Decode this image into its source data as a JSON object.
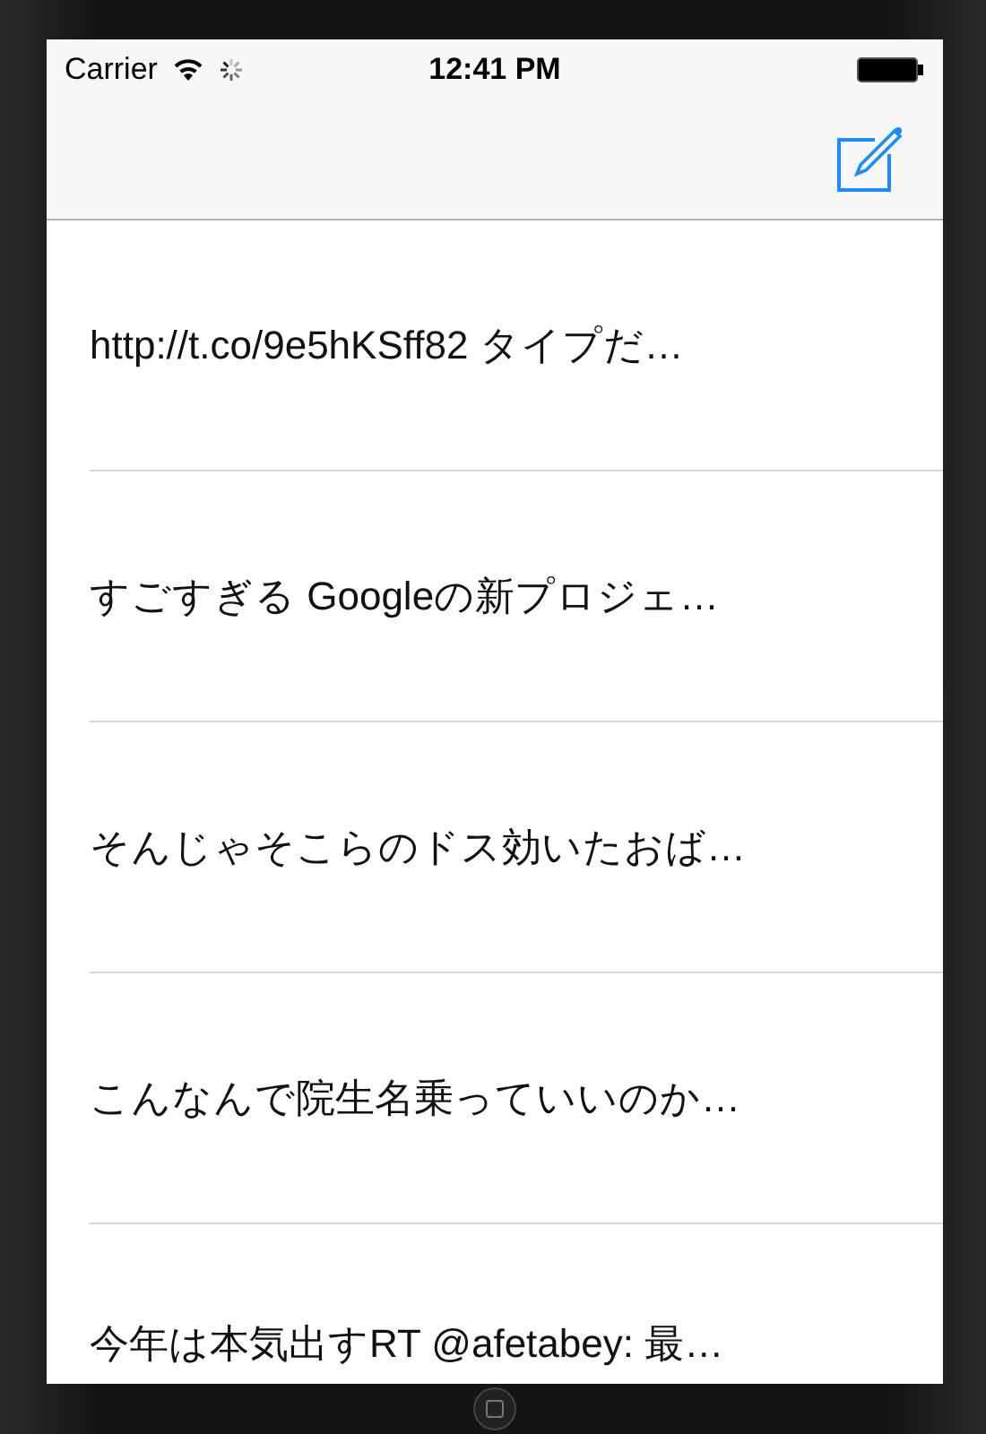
{
  "status_bar": {
    "carrier": "Carrier",
    "time": "12:41 PM",
    "loading": true
  },
  "nav_bar": {
    "compose_button": true
  },
  "rows": [
    {
      "text": "http://t.co/9e5hKSff82 タイプだ…"
    },
    {
      "text": "すごすぎる Googleの新プロジェ…"
    },
    {
      "text": "そんじゃそこらのドス効いたおば…"
    },
    {
      "text": "こんなんで院生名乗っていいのか…"
    },
    {
      "text": "今年は本気出すRT @afetabey: 最…"
    }
  ]
}
